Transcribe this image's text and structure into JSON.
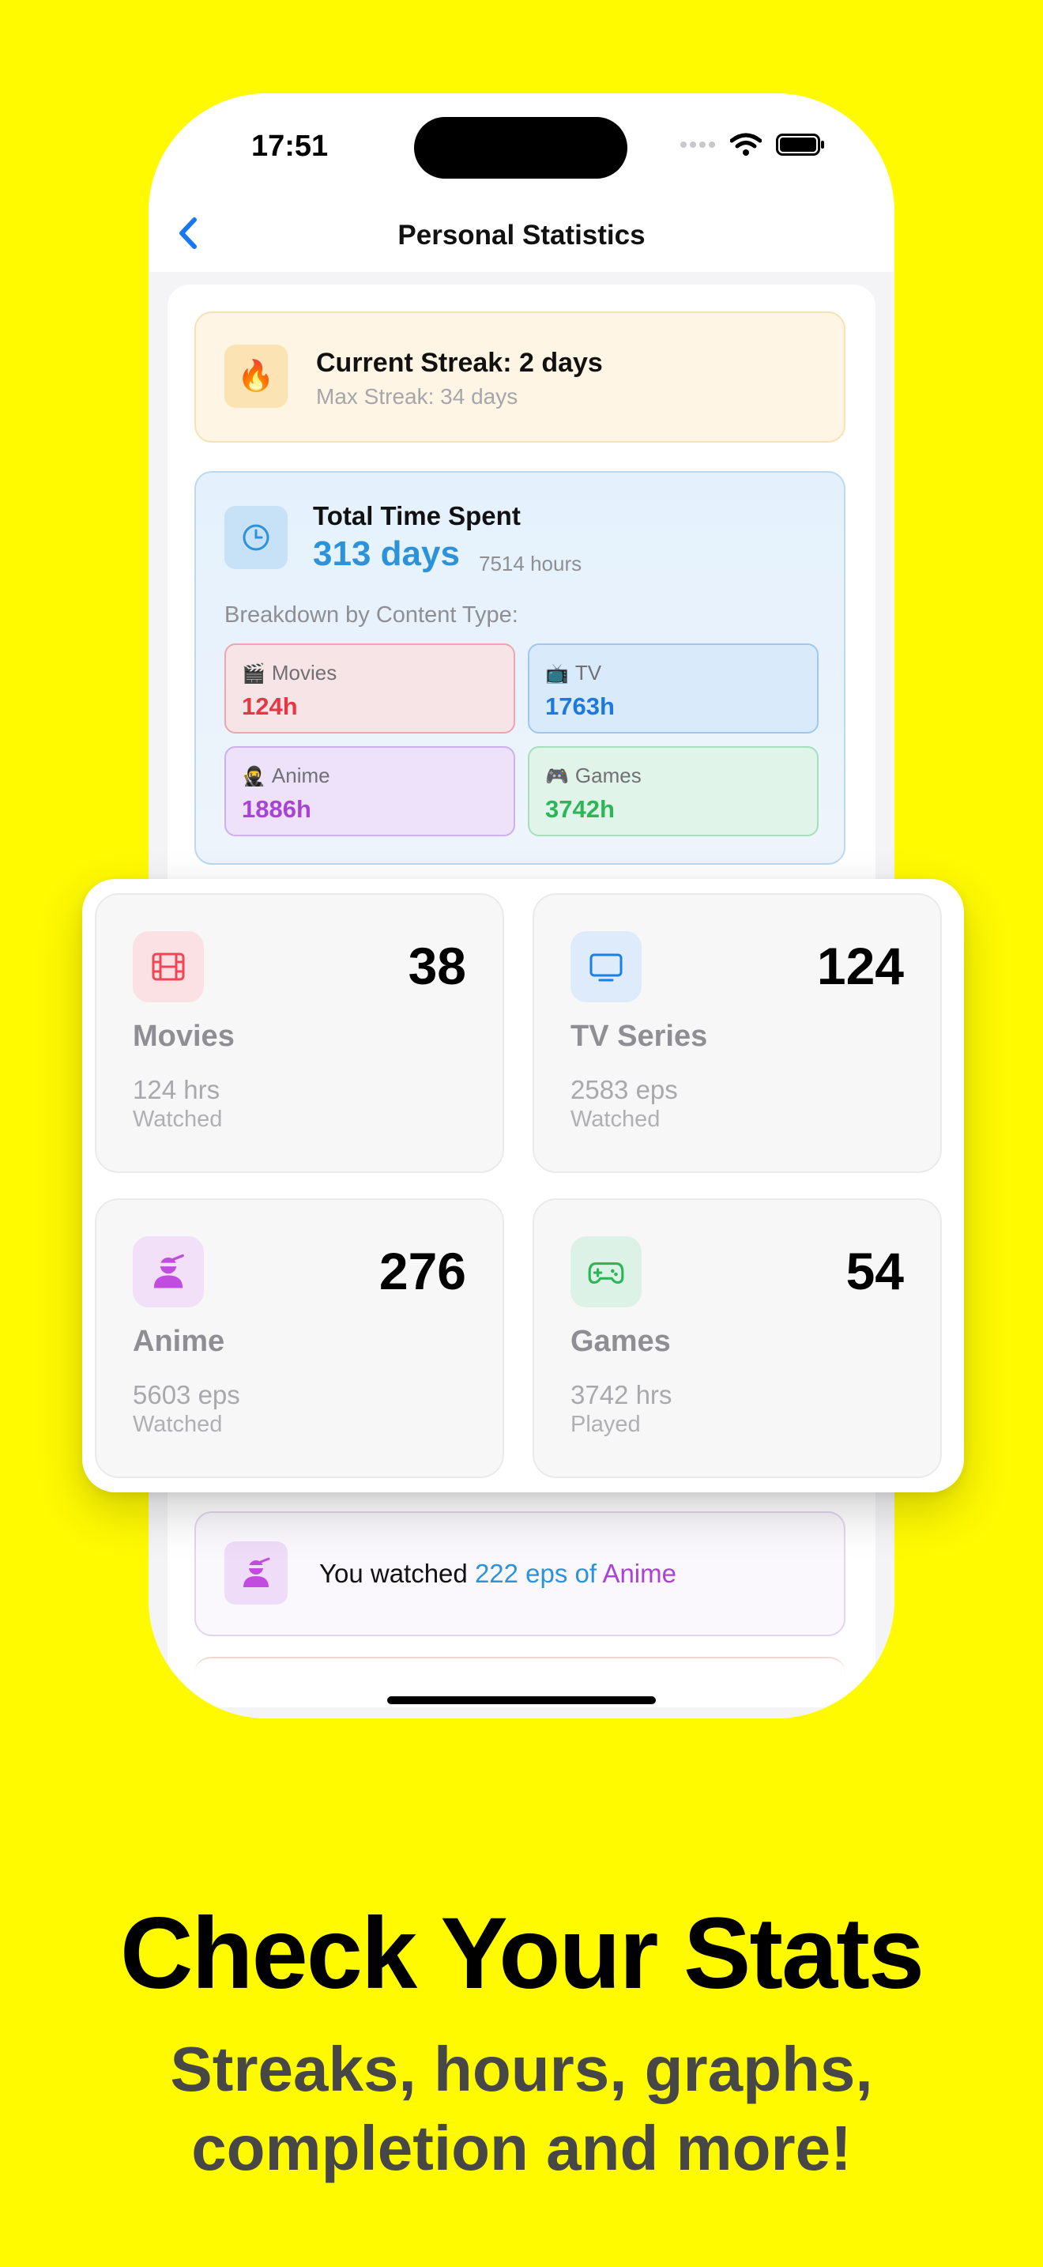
{
  "status_bar": {
    "time": "17:51"
  },
  "nav": {
    "title": "Personal Statistics"
  },
  "streak": {
    "title": "Current Streak: 2 days",
    "subtitle": "Max Streak: 34 days",
    "icon": "fire-icon"
  },
  "time_spent": {
    "title": "Total Time Spent",
    "days": "313 days",
    "hours": "7514 hours",
    "breakdown_label": "Breakdown by Content Type:",
    "breakdown": [
      {
        "emoji": "🎬",
        "label": "Movies",
        "value": "124h",
        "color": "#E53845"
      },
      {
        "emoji": "📺",
        "label": "TV",
        "value": "1763h",
        "color": "#1B79E0"
      },
      {
        "emoji": "🥷",
        "label": "Anime",
        "value": "1886h",
        "color": "#A943D6"
      },
      {
        "emoji": "🎮",
        "label": "Games",
        "value": "3742h",
        "color": "#2CB657"
      }
    ]
  },
  "tiles": [
    {
      "icon": "film-icon",
      "count": "38",
      "name": "Movies",
      "value": "124 hrs",
      "caption": "Watched"
    },
    {
      "icon": "tv-icon",
      "count": "124",
      "name": "TV Series",
      "value": "2583 eps",
      "caption": "Watched"
    },
    {
      "icon": "ninja-icon",
      "count": "276",
      "name": "Anime",
      "value": "5603 eps",
      "caption": "Watched"
    },
    {
      "icon": "gamepad-icon",
      "count": "54",
      "name": "Games",
      "value": "3742 hrs",
      "caption": "Played"
    }
  ],
  "watched": {
    "prefix": "You watched",
    "highlight": "222 eps of",
    "type": "Anime"
  },
  "caption": {
    "headline": "Check Your Stats",
    "sub1": "Streaks, hours, graphs,",
    "sub2": "completion and more!"
  },
  "colors": {
    "background": "#FFFA00",
    "accent_blue": "#2C93DB",
    "anime_purple": "#A943D6"
  }
}
